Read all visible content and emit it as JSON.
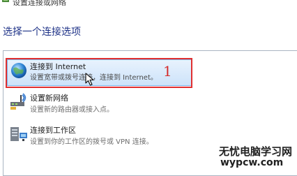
{
  "window": {
    "title": "设置连接或网络"
  },
  "heading": "选择一个连接选项",
  "options": [
    {
      "title": "连接到 Internet",
      "desc": "设置宽带或拨号连接，连接到 Internet。",
      "icon": "globe-icon",
      "selected": true
    },
    {
      "title": "设置新网络",
      "desc": "设置新的路由器或接入点。",
      "icon": "router-icon",
      "selected": false
    },
    {
      "title": "连接到工作区",
      "desc": "设置到你的工作区的拨号或 VPN 连接。",
      "icon": "workplace-icon",
      "selected": false
    }
  ],
  "annotation": {
    "number": "1"
  },
  "watermark": {
    "line1": "无忧电脑学习网",
    "line2": "wypcw.com"
  },
  "colors": {
    "heading": "#1e3287",
    "selection": "#cde3fa",
    "annotation": "#e03030"
  }
}
